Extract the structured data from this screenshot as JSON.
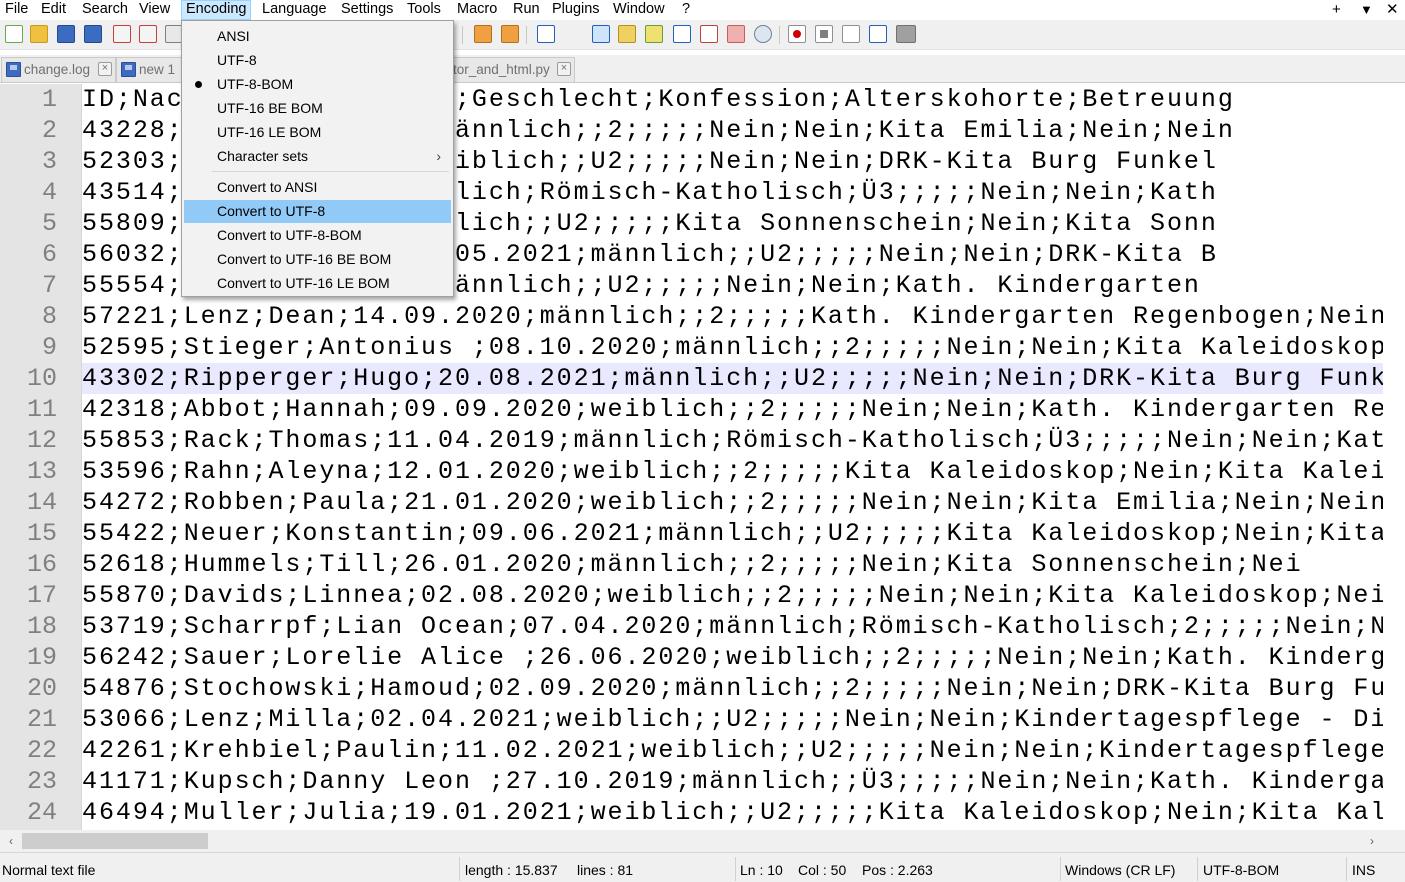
{
  "menubar": {
    "items": [
      "File",
      "Edit",
      "Search",
      "View",
      "Encoding",
      "Language",
      "Settings",
      "Tools",
      "Macro",
      "Run",
      "Plugins",
      "Window",
      "?"
    ],
    "active": "Encoding",
    "right_controls": {
      "add": "+",
      "dropdown": "▼",
      "close": "✕"
    }
  },
  "toolbar": {
    "icons": [
      "new-file-icon",
      "open-file-icon",
      "save-icon",
      "save-all-icon",
      "close-icon",
      "close-all-icon",
      "print-icon",
      "cut-icon",
      "copy-icon",
      "paste-icon",
      "undo-icon",
      "redo-icon",
      "find-icon",
      "replace-icon",
      "zoom-in-icon",
      "zoom-out-icon",
      "sync-v-icon",
      "sync-h-icon",
      "word-wrap-icon",
      "show-all-chars-icon",
      "indent-guide-icon",
      "udl-icon",
      "doc-map-icon",
      "function-list-icon",
      "folder-as-workspace-icon",
      "doc-list-icon",
      "monitoring-icon",
      "record-macro-icon",
      "stop-record-icon",
      "play-macro-icon",
      "run-macro-multiple-icon",
      "save-macro-icon"
    ]
  },
  "tabs": [
    {
      "label": "change.log"
    },
    {
      "label": "new 1"
    },
    {
      "label": "tor_and_html.py"
    }
  ],
  "encoding_menu": {
    "items": [
      {
        "label": "ANSI",
        "checked": false
      },
      {
        "label": "UTF-8",
        "checked": false
      },
      {
        "label": "UTF-8-BOM",
        "checked": true
      },
      {
        "label": "UTF-16 BE BOM",
        "checked": false
      },
      {
        "label": "UTF-16 LE BOM",
        "checked": false
      },
      {
        "label": "Character sets",
        "submenu": true,
        "arrow": "›"
      },
      {
        "label": "Convert to ANSI"
      },
      {
        "label": "Convert to UTF-8",
        "highlighted": true
      },
      {
        "label": "Convert to UTF-8-BOM"
      },
      {
        "label": "Convert to UTF-16 BE BOM"
      },
      {
        "label": "Convert to UTF-16 LE BOM"
      }
    ]
  },
  "editor": {
    "current_line": 10,
    "lines": [
      {
        "n": "1",
        "text": "ID;Nac      burtsdatum;Geschlecht;Konfession;Alterskohorte;Betreuung"
      },
      {
        "n": "2",
        "text": "43228;      .11.2019;männlich;;2;;;;;Nein;Nein;Kita Emilia;Nein;Nein"
      },
      {
        "n": "3",
        "text": "52303;      12.2020;weiblich;;U2;;;;;Nein;Nein;DRK-Kita Burg Funkel"
      },
      {
        "n": "4",
        "text": "43514;      .2019;männlich;Römisch-Katholisch;Ü3;;;;;Nein;Nein;Kath"
      },
      {
        "n": "5",
        "text": "55809;      .2021;männlich;;U2;;;;;Kita Sonnenschein;Nein;Kita Sonn"
      },
      {
        "n": "6",
        "text": "56032;      ilhelm;03.05.2021;männlich;;U2;;;;;Nein;Nein;DRK-Kita B"
      },
      {
        "n": "7",
        "text": "55554;      .06.2021;männlich;;U2;;;;;Nein;Nein;Kath. Kindergarten"
      },
      {
        "n": "8",
        "text": "57221;Lenz;Dean;14.09.2020;männlich;;2;;;;;Kath. Kindergarten Regenbogen;Nein"
      },
      {
        "n": "9",
        "text": "52595;Stieger;Antonius ;08.10.2020;männlich;;2;;;;;Nein;Nein;Kita Kaleidoskop"
      },
      {
        "n": "10",
        "text": "43302;Ripperger;Hugo;20.08.2021;männlich;;U2;;;;;Nein;Nein;DRK-Kita Burg Funk"
      },
      {
        "n": "11",
        "text": "42318;Abbot;Hannah;09.09.2020;weiblich;;2;;;;;Nein;Nein;Kath. Kindergarten Re"
      },
      {
        "n": "12",
        "text": "55853;Rack;Thomas;11.04.2019;männlich;Römisch-Katholisch;Ü3;;;;;Nein;Nein;Kat"
      },
      {
        "n": "13",
        "text": "53596;Rahn;Aleyna;12.01.2020;weiblich;;2;;;;;Kita Kaleidoskop;Nein;Kita Kalei"
      },
      {
        "n": "14",
        "text": "54272;Robben;Paula;21.01.2020;weiblich;;2;;;;;Nein;Nein;Kita Emilia;Nein;Nein"
      },
      {
        "n": "15",
        "text": "55422;Neuer;Konstantin;09.06.2021;männlich;;U2;;;;;Kita Kaleidoskop;Nein;Kita"
      },
      {
        "n": "16",
        "text": "52618;Hummels;Till;26.01.2020;männlich;;2;;;;;Nein;Kita Sonnenschein;Nei"
      },
      {
        "n": "17",
        "text": "55870;Davids;Linnea;02.08.2020;weiblich;;2;;;;;Nein;Nein;Kita Kaleidoskop;Nei"
      },
      {
        "n": "18",
        "text": "53719;Scharrpf;Lian Ocean;07.04.2020;männlich;Römisch-Katholisch;2;;;;;Nein;N"
      },
      {
        "n": "19",
        "text": "56242;Sauer;Lorelie Alice ;26.06.2020;weiblich;;2;;;;;Nein;Nein;Kath. Kinderg"
      },
      {
        "n": "20",
        "text": "54876;Stochowski;Hamoud;02.09.2020;männlich;;2;;;;;Nein;Nein;DRK-Kita Burg Fu"
      },
      {
        "n": "21",
        "text": "53066;Lenz;Milla;02.04.2021;weiblich;;U2;;;;;Nein;Nein;Kindertagespflege - Di"
      },
      {
        "n": "22",
        "text": "42261;Krehbiel;Paulin;11.02.2021;weiblich;;U2;;;;;Nein;Nein;Kindertagespflege"
      },
      {
        "n": "23",
        "text": "41171;Kupsch;Danny Leon ;27.10.2019;männlich;;Ü3;;;;;Nein;Nein;Kath. Kinderga"
      },
      {
        "n": "24",
        "text": "46494;Muller;Julia;19.01.2021;weiblich;;U2;;;;;Kita Kaleidoskop;Nein;Kita Kal"
      }
    ]
  },
  "hscroll": {
    "left_arrow": "‹",
    "right_arrow": "›"
  },
  "statusbar": {
    "file_type": "Normal text file",
    "length": "length : 15.837",
    "lines": "lines : 81",
    "ln": "Ln : 10",
    "col": "Col : 50",
    "pos": "Pos : 2.263",
    "eol": "Windows (CR LF)",
    "encoding": "UTF-8-BOM",
    "mode": "INS"
  },
  "colors": {
    "menu_highlight": "#91c9f7",
    "current_line": "#e8e8ff",
    "gutter": "#e4e4e4"
  }
}
